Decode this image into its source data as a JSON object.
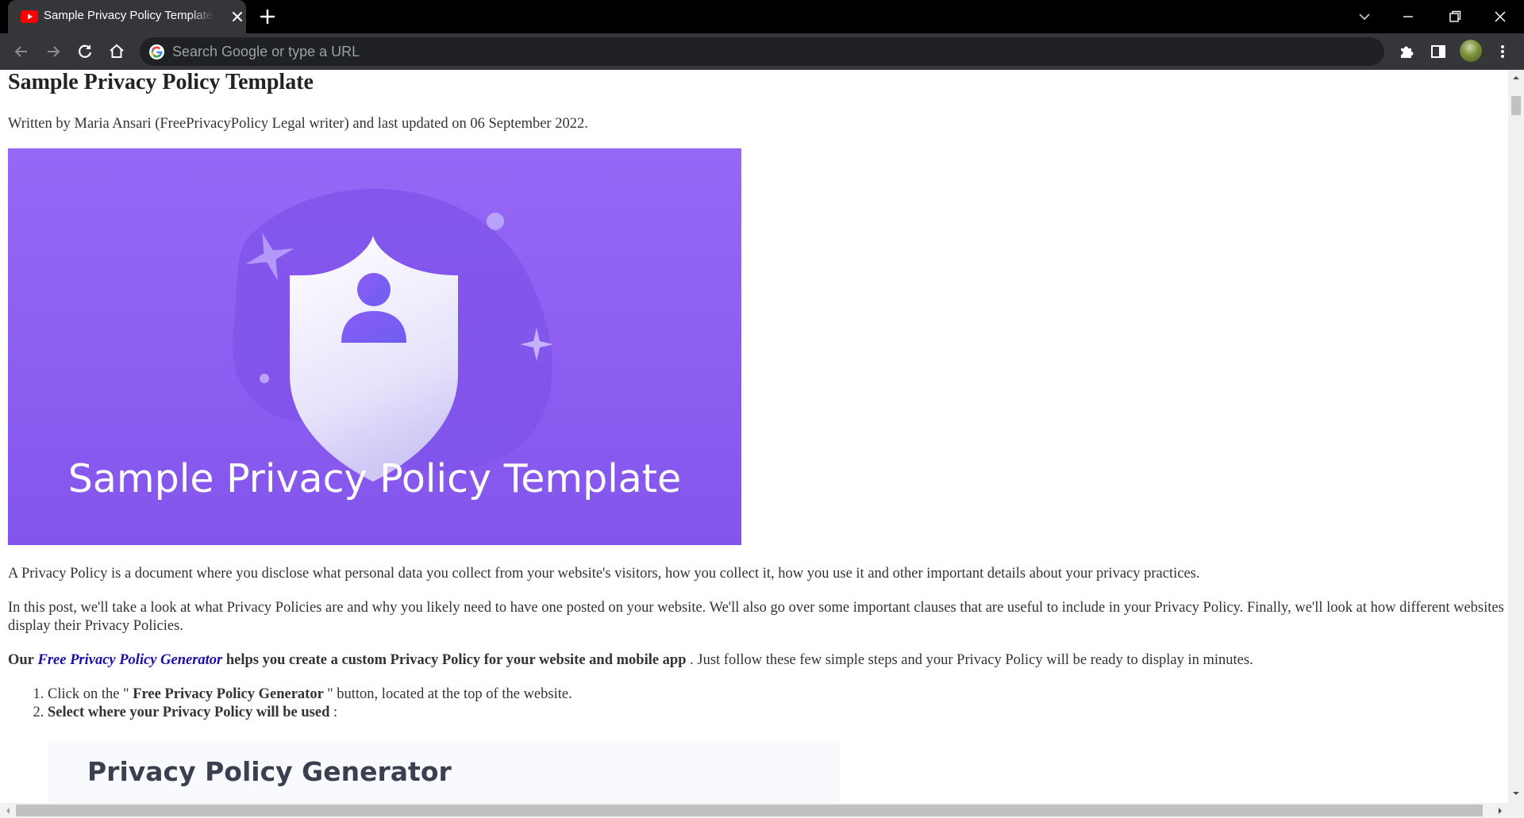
{
  "browser": {
    "tab_title": "Sample Privacy Policy Template -",
    "omnibox_placeholder": "Search Google or type a URL"
  },
  "article": {
    "title": "Sample Privacy Policy Template",
    "byline": "Written by Maria Ansari (FreePrivacyPolicy Legal writer) and last updated on 06 September 2022.",
    "hero_text": "Sample Privacy Policy Template",
    "para1": "A Privacy Policy is a document where you disclose what personal data you collect from your website's visitors, how you collect it, how you use it and other important details about your privacy practices.",
    "para2": "In this post, we'll take a look at what Privacy Policies are and why you likely need to have one posted on your website. We'll also go over some important clauses that are useful to include in your Privacy Policy. Finally, we'll look at how different websites display their Privacy Policies.",
    "para3": {
      "lead": "Our",
      "link": "Free Privacy Policy Generator",
      "bold": "helps you create a custom Privacy Policy for your website and mobile app",
      "rest": ". Just follow these few simple steps and your Privacy Policy will be ready to display in minutes."
    },
    "steps": [
      {
        "pre": "Click on the \"",
        "bold": " Free Privacy Policy Generator ",
        "post": "\" button, located at the top of the website."
      },
      {
        "pre": "",
        "bold": "Select where your Privacy Policy will be used",
        "post": " :"
      }
    ],
    "generator_card_title": "Privacy Policy Generator"
  },
  "colors": {
    "hero_background": "#9768f6",
    "link": "#1a0dab",
    "tabbar": "#000000",
    "toolbar": "#35363a"
  },
  "icons": [
    "youtube-favicon",
    "close-icon",
    "plus-icon",
    "chevron-down-icon",
    "minimize-icon",
    "restore-icon",
    "back-icon",
    "forward-icon",
    "reload-icon",
    "home-icon",
    "google-icon",
    "extensions-icon",
    "side-panel-icon",
    "more-icon",
    "shield-user-illustration"
  ]
}
